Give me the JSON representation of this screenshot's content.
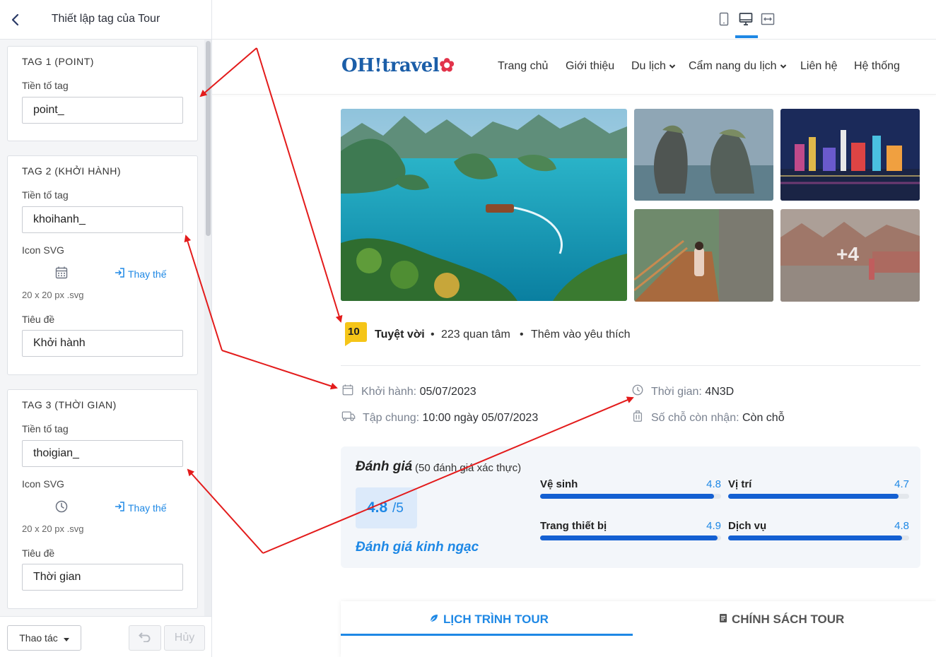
{
  "panel": {
    "title": "Thiết lập tag của Tour",
    "tag1": {
      "heading": "TAG 1 (POINT)",
      "prefix_label": "Tiền tố tag",
      "prefix_value": "point_"
    },
    "tag2": {
      "heading": "TAG 2 (KHỞI HÀNH)",
      "prefix_label": "Tiền tố tag",
      "prefix_value": "khoihanh_",
      "icon_label": "Icon SVG",
      "icon": "calendar-icon",
      "replace_label": "Thay thế",
      "icon_hint": "20 x 20 px .svg",
      "title_label": "Tiêu đề",
      "title_value": "Khởi hành"
    },
    "tag3": {
      "heading": "TAG 3 (THỜI GIAN)",
      "prefix_label": "Tiền tố tag",
      "prefix_value": "thoigian_",
      "icon_label": "Icon SVG",
      "icon": "clock-icon",
      "replace_label": "Thay thế",
      "icon_hint": "20 x 20 px .svg",
      "title_label": "Tiêu đề",
      "title_value": "Thời gian"
    },
    "footer": {
      "ops_label": "Thao tác",
      "cancel_label": "Hủy"
    }
  },
  "devices": [
    "mobile",
    "desktop",
    "fullwidth"
  ],
  "active_device": "desktop",
  "site": {
    "logo": "OH!travel",
    "nav": [
      "Trang chủ",
      "Giới thiệu",
      "Du lịch",
      "Cẩm nang du lịch",
      "Liên hệ",
      "Hệ thống"
    ],
    "more_photos": "+4",
    "score": "10",
    "score_text": "Tuyệt vời",
    "interest": "223 quan tâm",
    "favorite": "Thêm vào yêu thích",
    "depart_label": "Khởi hành:",
    "depart_value": "05/07/2023",
    "duration_label": "Thời gian:",
    "duration_value": "4N3D",
    "meet_label": "Tập chung:",
    "meet_value": "10:00 ngày 05/07/2023",
    "seats_label": "Số chỗ còn nhận:",
    "seats_value": "Còn chỗ",
    "review": {
      "title": "Đánh giá",
      "count": "(50 đánh giá xác thực)",
      "score": "4.8",
      "out_of": "/5",
      "verdict": "Đánh giá kinh ngạc",
      "criteria": [
        {
          "name": "Vệ sinh",
          "value": "4.8",
          "fraction": 0.96
        },
        {
          "name": "Vị trí",
          "value": "4.7",
          "fraction": 0.94
        },
        {
          "name": "Trang thiết bị",
          "value": "4.9",
          "fraction": 0.98
        },
        {
          "name": "Dịch vụ",
          "value": "4.8",
          "fraction": 0.96
        }
      ]
    },
    "tabs": [
      "LỊCH TRÌNH TOUR",
      "CHÍNH SÁCH TOUR"
    ]
  },
  "colors": {
    "accent": "#1e88e5",
    "bar": "#1460d2",
    "arrow": "#e31b1b",
    "badge": "#f5c518"
  }
}
